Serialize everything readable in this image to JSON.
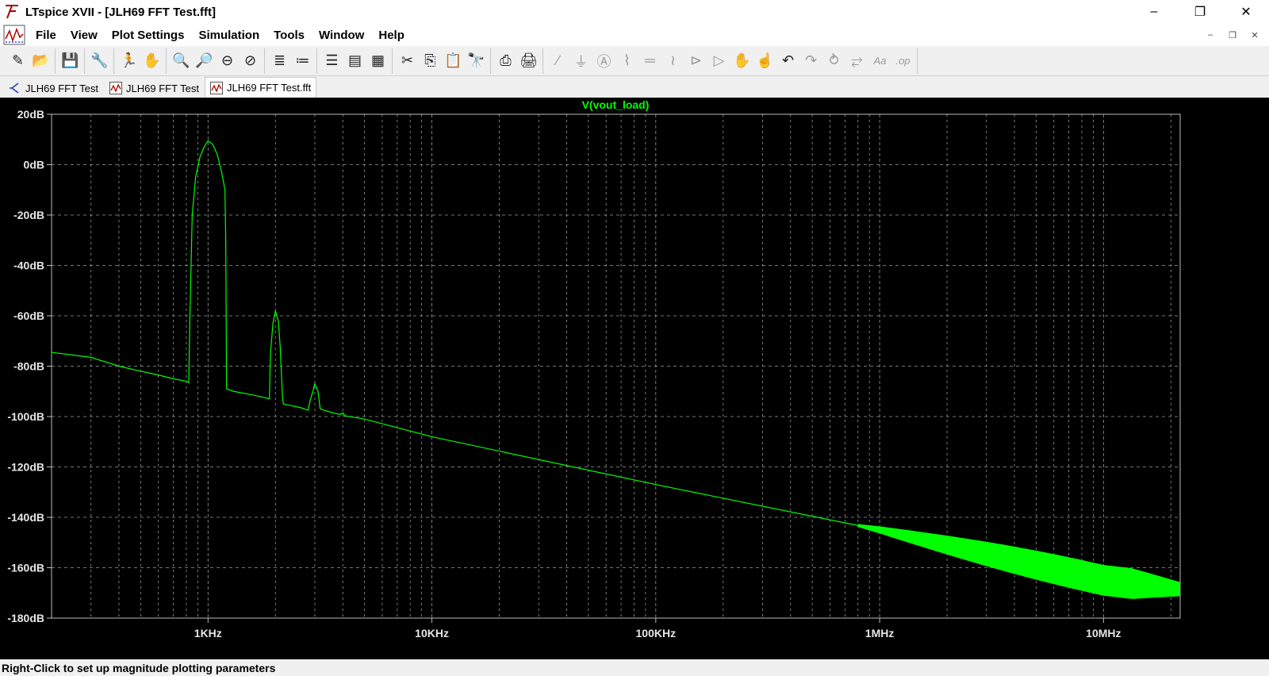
{
  "window": {
    "title": "LTspice XVII - [JLH69 FFT Test.fft]",
    "minimize_glyph": "–",
    "restore_glyph": "❐",
    "close_glyph": "✕"
  },
  "menu": {
    "items": [
      "File",
      "View",
      "Plot Settings",
      "Simulation",
      "Tools",
      "Window",
      "Help"
    ],
    "mdi_minimize": "–",
    "mdi_restore": "❐",
    "mdi_close": "✕"
  },
  "toolbar": {
    "groups": [
      [
        {
          "icon": "new-schematic-icon",
          "glyph": "✎"
        },
        {
          "icon": "open-folder-icon",
          "glyph": "📂"
        }
      ],
      [
        {
          "icon": "save-icon",
          "glyph": "💾"
        }
      ],
      [
        {
          "icon": "control-panel-icon",
          "glyph": "🔧"
        }
      ],
      [
        {
          "icon": "run-icon",
          "glyph": "🏃",
          "disabled": true
        },
        {
          "icon": "halt-icon",
          "glyph": "✋",
          "disabled": true
        }
      ],
      [
        {
          "icon": "zoom-in-icon",
          "glyph": "🔍"
        },
        {
          "icon": "zoom-pan-icon",
          "glyph": "🔎"
        },
        {
          "icon": "zoom-out-icon",
          "glyph": "⊖"
        },
        {
          "icon": "zoom-fit-icon",
          "glyph": "⊘"
        }
      ],
      [
        {
          "icon": "autorange-icon",
          "glyph": "≣"
        },
        {
          "icon": "manual-limits-icon",
          "glyph": "≔"
        }
      ],
      [
        {
          "icon": "tile-horizontal-icon",
          "glyph": "☰"
        },
        {
          "icon": "tile-vertical-icon",
          "glyph": "▤"
        },
        {
          "icon": "cascade-icon",
          "glyph": "▦"
        }
      ],
      [
        {
          "icon": "cut-icon",
          "glyph": "✂"
        },
        {
          "icon": "copy-icon",
          "glyph": "⎘"
        },
        {
          "icon": "paste-icon",
          "glyph": "📋"
        },
        {
          "icon": "find-icon",
          "glyph": "🔭"
        }
      ],
      [
        {
          "icon": "print-setup-icon",
          "glyph": "⎙"
        },
        {
          "icon": "print-icon",
          "glyph": "🖨"
        }
      ],
      [
        {
          "icon": "wire-icon",
          "glyph": "∕",
          "disabled": true
        },
        {
          "icon": "ground-icon",
          "glyph": "⏚",
          "disabled": true
        },
        {
          "icon": "label-net-icon",
          "glyph": "Ⓐ",
          "disabled": true
        },
        {
          "icon": "resistor-icon",
          "glyph": "⌇",
          "disabled": true
        },
        {
          "icon": "capacitor-icon",
          "glyph": "═",
          "disabled": true
        },
        {
          "icon": "inductor-icon",
          "glyph": "≀",
          "disabled": true
        },
        {
          "icon": "diode-icon",
          "glyph": "⊳",
          "disabled": true
        },
        {
          "icon": "component-icon",
          "glyph": "▷",
          "disabled": true
        },
        {
          "icon": "move-icon",
          "glyph": "✋",
          "disabled": true
        },
        {
          "icon": "drag-icon",
          "glyph": "☝",
          "disabled": true
        },
        {
          "icon": "undo-icon",
          "glyph": "↶"
        },
        {
          "icon": "redo-icon",
          "glyph": "↷",
          "disabled": true
        },
        {
          "icon": "rotate-icon",
          "glyph": "⥁",
          "disabled": true
        },
        {
          "icon": "mirror-icon",
          "glyph": "⥂",
          "disabled": true
        },
        {
          "icon": "text-icon",
          "glyph": "Aa",
          "disabled": true
        },
        {
          "icon": "spice-directive-icon",
          "glyph": ".op",
          "disabled": true
        }
      ]
    ]
  },
  "tabs": [
    {
      "label": "JLH69 FFT Test",
      "icon": "schematic-icon",
      "active": false
    },
    {
      "label": "JLH69 FFT Test",
      "icon": "waveform-icon",
      "active": false
    },
    {
      "label": "JLH69 FFT Test.fft",
      "icon": "waveform-icon",
      "active": true
    }
  ],
  "colors": {
    "trace": "#00ff00",
    "plot_background": "#000000",
    "grid": "#9a9a9a",
    "axis_text": "#e6e6e6"
  },
  "chart_data": {
    "type": "line",
    "title": "V(vout_load)",
    "xlabel": "",
    "ylabel": "",
    "xscale": "log",
    "x_tick_labels": [
      "1KHz",
      "10KHz",
      "100KHz",
      "1MHz",
      "10MHz"
    ],
    "x_tick_values": [
      1000,
      10000,
      100000,
      1000000,
      10000000
    ],
    "y_tick_labels": [
      "20dB",
      "0dB",
      "-20dB",
      "-40dB",
      "-60dB",
      "-80dB",
      "-100dB",
      "-120dB",
      "-140dB",
      "-160dB",
      "-180dB"
    ],
    "y_tick_values": [
      20,
      0,
      -20,
      -40,
      -60,
      -80,
      -100,
      -120,
      -140,
      -160,
      -180
    ],
    "xlim": [
      200,
      22000000
    ],
    "ylim": [
      -180,
      20
    ],
    "grid": true,
    "series": [
      {
        "name": "V(vout_load)",
        "x": [
          200,
          300,
          400,
          500,
          600,
          700,
          800,
          820,
          830,
          850,
          880,
          920,
          960,
          1000,
          1050,
          1100,
          1150,
          1190,
          1200,
          1210,
          1300,
          1500,
          1800,
          1880,
          1900,
          1950,
          2000,
          2060,
          2100,
          2150,
          2170,
          2300,
          2600,
          2800,
          2850,
          2950,
          3000,
          3100,
          3170,
          3300,
          3600,
          3900,
          4000,
          4100,
          5000,
          10000,
          100000,
          1000000,
          10000000,
          22000000
        ],
        "y": [
          -74.5,
          -76.5,
          -80,
          -82,
          -83.5,
          -85,
          -86,
          -86.5,
          -60,
          -20,
          -5,
          3,
          7,
          9.5,
          8,
          4,
          -3,
          -10,
          -30,
          -89,
          -90,
          -91,
          -92.5,
          -93,
          -75,
          -63,
          -58,
          -62,
          -72,
          -92,
          -95,
          -95.5,
          -96.5,
          -97.5,
          -94,
          -89.5,
          -87,
          -90,
          -97,
          -97.5,
          -98.5,
          -99.2,
          -98.5,
          -99.7,
          -101,
          -108,
          -127,
          -145,
          -165,
          -168.5
        ]
      }
    ]
  },
  "statusbar": {
    "text": "Right-Click to set up magnitude plotting parameters"
  }
}
